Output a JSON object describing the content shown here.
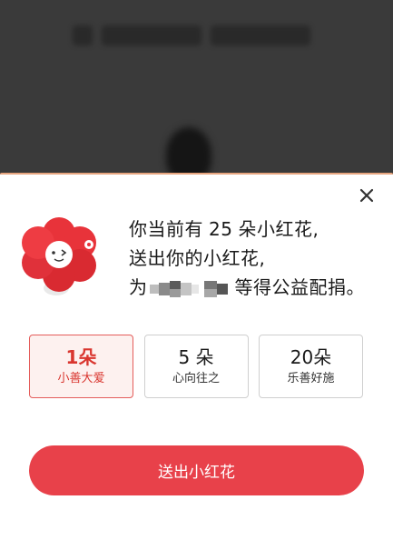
{
  "popup": {
    "message": {
      "line1_prefix": "你当前有",
      "line1_count": "25",
      "line1_suffix": "朵小红花,",
      "line2": "送出你的小红花,",
      "line3_prefix": "为",
      "line3_suffix": "等得公益配捐。"
    },
    "options": [
      {
        "amount": "1朵",
        "subtitle": "小善大爱",
        "selected": true
      },
      {
        "amount": "5 朵",
        "subtitle": "心向往之",
        "selected": false
      },
      {
        "amount": "20朵",
        "subtitle": "乐善好施",
        "selected": false
      }
    ],
    "send_button": "送出小红花"
  },
  "colors": {
    "accent": "#e8414a",
    "selected_text": "#d9362f",
    "selected_bg": "#fdf1ef",
    "sheet_border": "#e7a57f"
  },
  "icons": {
    "close": "close-icon",
    "mascot": "red-flower-mascot"
  }
}
